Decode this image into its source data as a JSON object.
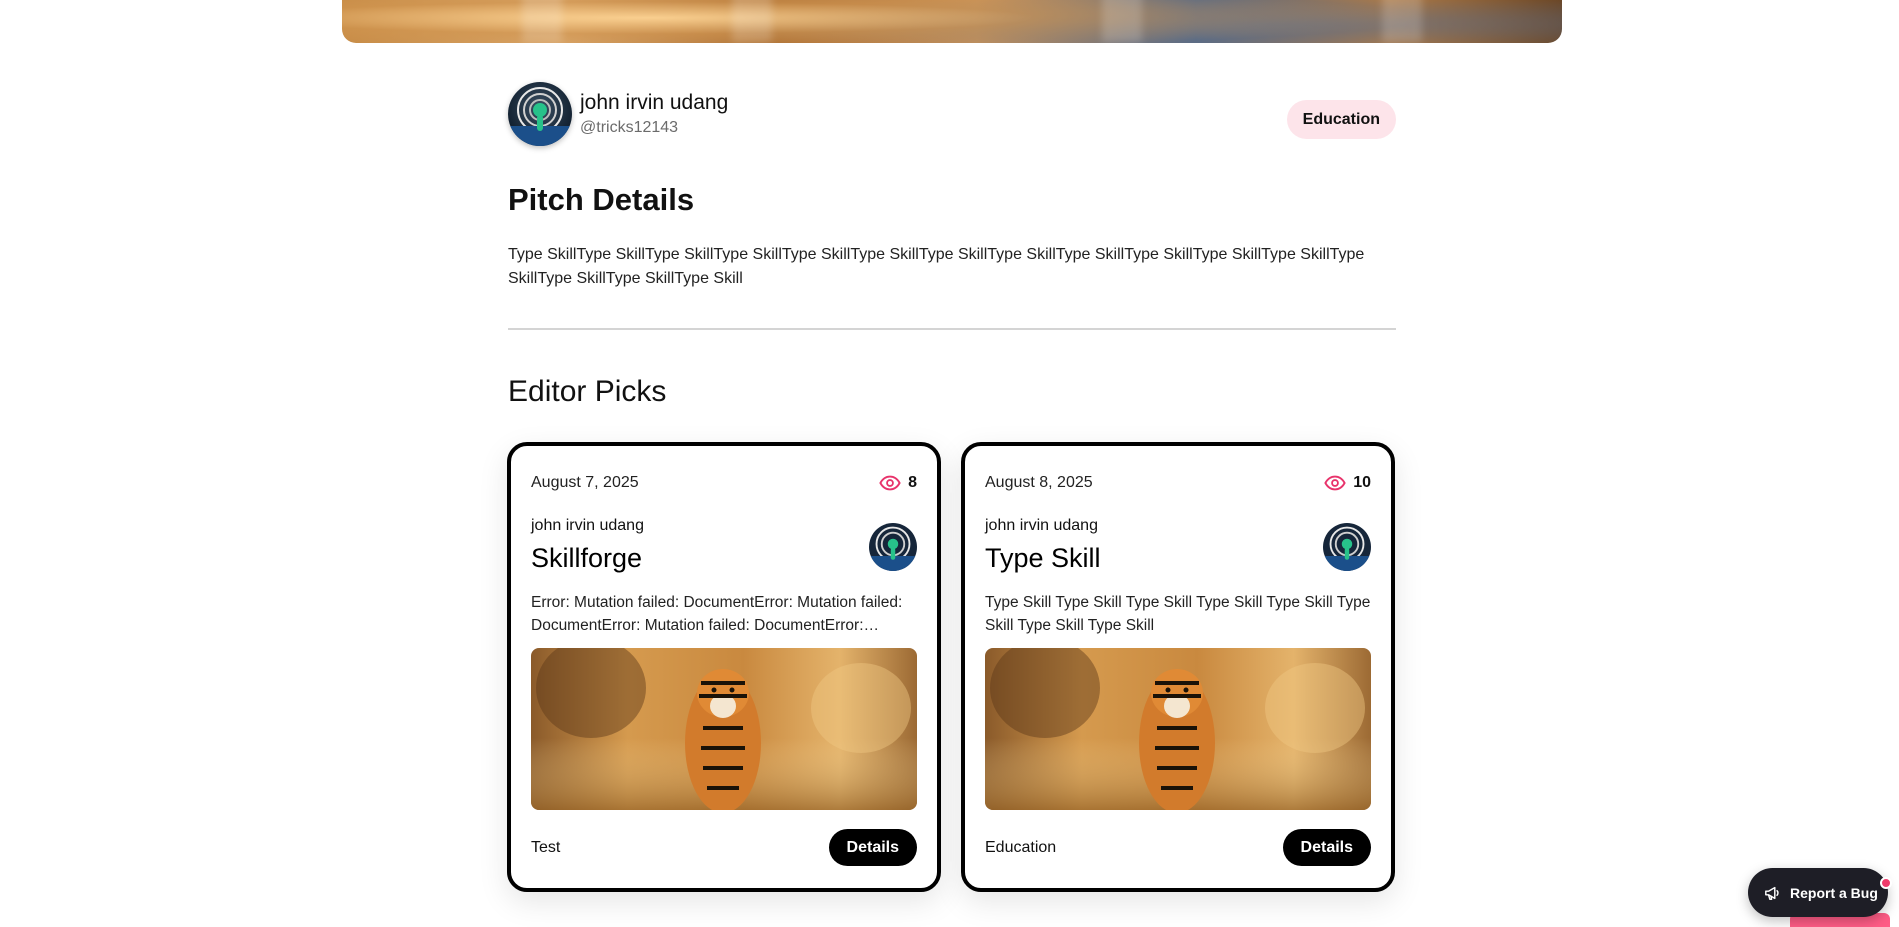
{
  "profile": {
    "name": "john irvin udang",
    "handle": "@tricks12143",
    "category": "Education"
  },
  "pitch": {
    "title": "Pitch Details",
    "body": "Type SkillType SkillType SkillType SkillType SkillType SkillType SkillType SkillType SkillType SkillType SkillType SkillType SkillType SkillType SkillType Skill"
  },
  "editor_picks": {
    "title": "Editor Picks",
    "cards": [
      {
        "date": "August 7, 2025",
        "views": "8",
        "author": "john irvin udang",
        "title": "Skillforge",
        "description": "Error: Mutation failed: DocumentError: Mutation failed: DocumentError: Mutation failed: DocumentError: Mutation failed",
        "category": "Test",
        "details_label": "Details"
      },
      {
        "date": "August 8, 2025",
        "views": "10",
        "author": "john irvin udang",
        "title": "Type Skill",
        "description": "Type Skill Type Skill Type Skill Type Skill Type Skill Type Skill Type Skill Type Skill",
        "category": "Education",
        "details_label": "Details"
      }
    ]
  },
  "report_bug": {
    "label": "Report a Bug"
  },
  "colors": {
    "accent_pink": "#e8336b",
    "pill_bg": "#fde4ea",
    "button_dark": "#000000",
    "bug_button": "#1e1e26"
  },
  "icons": {
    "views": "eye-icon",
    "report": "megaphone-icon"
  }
}
